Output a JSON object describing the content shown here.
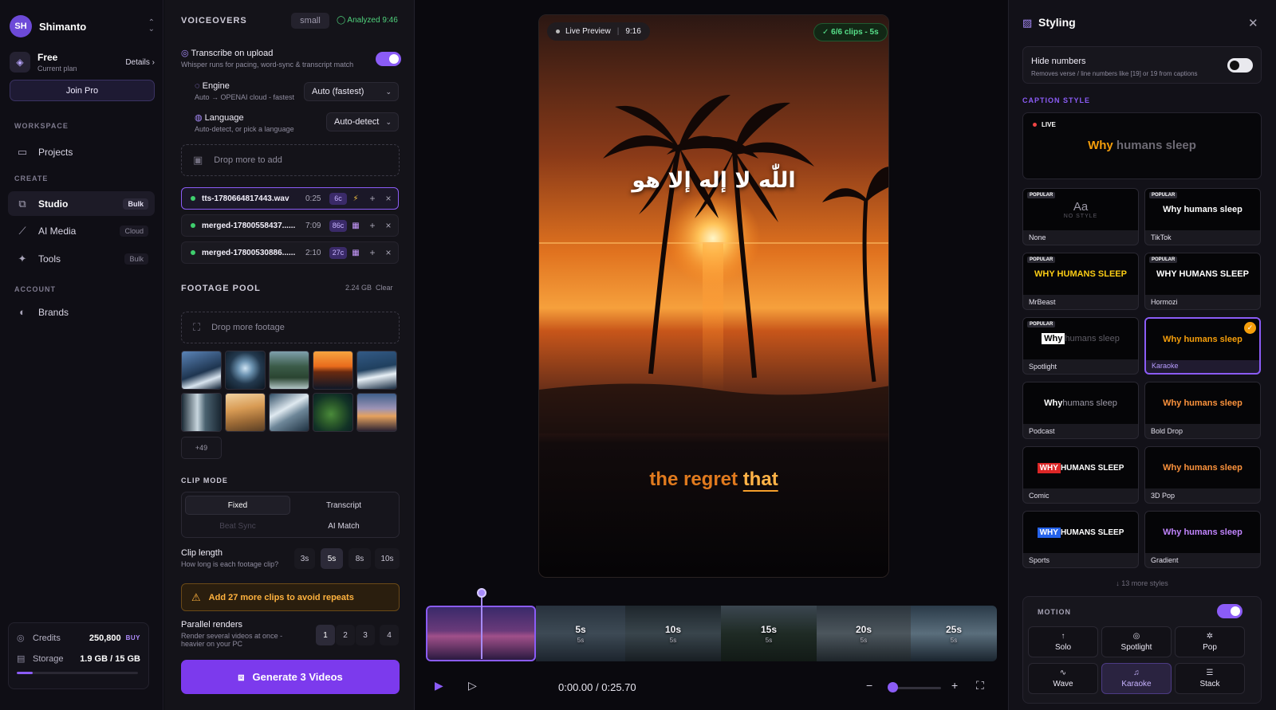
{
  "user": {
    "initials": "SH",
    "name": "Shimanto"
  },
  "plan": {
    "name": "Free",
    "subtitle": "Current plan",
    "details_label": "Details ›",
    "join_label": "Join Pro"
  },
  "sidebar": {
    "workspace_label": "WORKSPACE",
    "create_label": "CREATE",
    "account_label": "ACCOUNT",
    "items": [
      {
        "label": "Projects",
        "badge": ""
      },
      {
        "label": "Studio",
        "badge": "Bulk"
      },
      {
        "label": "AI Media",
        "badge": "Cloud"
      },
      {
        "label": "Tools",
        "badge": "Bulk"
      },
      {
        "label": "Brands",
        "badge": ""
      }
    ]
  },
  "usage": {
    "credits_label": "Credits",
    "credits_value": "250,800",
    "buy_label": "BUY",
    "storage_label": "Storage",
    "storage_value": "1.9 GB / 15 GB",
    "storage_fraction": 0.13
  },
  "voiceovers": {
    "title": "VOICEOVERS",
    "model_chip": "small",
    "analyzed": "Analyzed 9:46",
    "transcribe": {
      "title": "Transcribe on upload",
      "subtitle": "Whisper runs for pacing, word-sync & transcript match",
      "enabled": true
    },
    "engine": {
      "title": "Engine",
      "subtitle": "Auto → OPENAI cloud - fastest",
      "value": "Auto (fastest)"
    },
    "language": {
      "title": "Language",
      "subtitle": "Auto-detect, or pick a language",
      "value": "Auto-detect"
    },
    "drop_label": "Drop more to add",
    "files": [
      {
        "name": "tts-1780664817443.wav",
        "duration": "0:25",
        "clips": "6c"
      },
      {
        "name": "merged-17800558437......",
        "duration": "7:09",
        "clips": "86c"
      },
      {
        "name": "merged-17800530886......",
        "duration": "2:10",
        "clips": "27c"
      }
    ]
  },
  "footage": {
    "title": "FOOTAGE POOL",
    "size": "2.24 GB",
    "clear_label": "Clear",
    "drop_label": "Drop more footage",
    "more_count": "+49"
  },
  "clip_mode": {
    "title": "CLIP MODE",
    "options": [
      "Fixed",
      "Transcript",
      "Beat Sync",
      "AI Match"
    ],
    "selected": "Fixed"
  },
  "clip_length": {
    "title": "Clip length",
    "subtitle": "How long is each footage clip?",
    "options": [
      "3s",
      "5s",
      "8s",
      "10s"
    ],
    "selected": "5s"
  },
  "warning": "Add 27 more clips to avoid repeats",
  "parallel": {
    "title": "Parallel renders",
    "subtitle": "Render several videos at once - heavier on your PC",
    "options": [
      "1",
      "2",
      "3",
      "4"
    ],
    "selected": "1"
  },
  "generate_label": "Generate 3 Videos",
  "preview": {
    "live_label": "Live Preview",
    "aspect": "9:16",
    "clips_status": "✓ 6/6 clips - 5s",
    "arabic_text": "اللّٰه لا إله إلا هو",
    "caption_plain": "the regret ",
    "caption_highlight": "that"
  },
  "timeline": {
    "segments": [
      {
        "t": "",
        "s": ""
      },
      {
        "t": "5s",
        "s": "5s"
      },
      {
        "t": "10s",
        "s": "5s"
      },
      {
        "t": "15s",
        "s": "5s"
      },
      {
        "t": "20s",
        "s": "5s"
      },
      {
        "t": "25s",
        "s": "5s"
      }
    ],
    "time_current": "0:00.00",
    "time_sep": "/",
    "time_total": "0:25.70"
  },
  "styling": {
    "title": "Styling",
    "hide_numbers": {
      "title": "Hide numbers",
      "subtitle": "Removes verse / line numbers like [19] or 19 from captions",
      "enabled": false
    },
    "caption_style_label": "CAPTION STYLE",
    "live_label": "LIVE",
    "live_sample_a": "Why",
    "live_sample_b": " humans sleep",
    "popular_label": "POPULAR",
    "styles": [
      {
        "name": "None",
        "preview": "Aa",
        "sub": "NO STYLE",
        "popular": true
      },
      {
        "name": "TikTok",
        "preview": "Why humans sleep",
        "popular": true
      },
      {
        "name": "MrBeast",
        "preview": "WHY HUMANS SLEEP",
        "popular": true
      },
      {
        "name": "Hormozi",
        "preview": "WHY HUMANS SLEEP",
        "popular": true
      },
      {
        "name": "Spotlight",
        "preview_a": "Why",
        "preview_b": " humans sleep",
        "popular": true
      },
      {
        "name": "Karaoke",
        "preview": "Why humans sleep",
        "selected": true
      },
      {
        "name": "Podcast",
        "preview_a": "Why",
        "preview_b": " humans sleep"
      },
      {
        "name": "Bold Drop",
        "preview": "Why humans sleep"
      },
      {
        "name": "Comic",
        "preview_a": "WHY",
        "preview_b": " HUMANS SLEEP"
      },
      {
        "name": "3D Pop",
        "preview": "Why humans sleep"
      },
      {
        "name": "Sports",
        "preview_a": "WHY",
        "preview_b": " HUMANS SLEEP"
      },
      {
        "name": "Gradient",
        "preview": "Why humans sleep"
      }
    ],
    "more_styles": "↓ 13 more styles",
    "motion": {
      "label": "MOTION",
      "enabled": true,
      "options": [
        "Solo",
        "Spotlight",
        "Pop",
        "Wave",
        "Karaoke",
        "Stack"
      ],
      "selected": "Karaoke"
    }
  },
  "colors": {
    "accent": "#8b5cf6",
    "success": "#4fd17c",
    "warning": "#ffb23e"
  }
}
